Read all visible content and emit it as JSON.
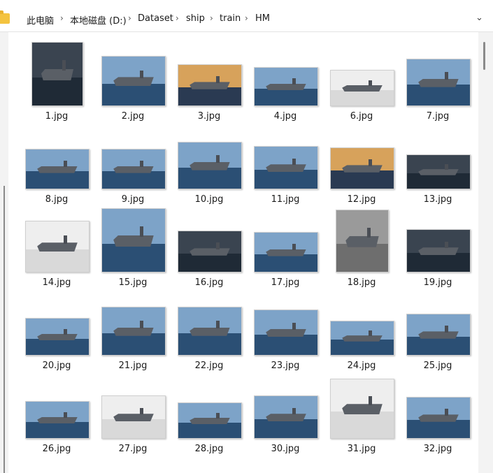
{
  "breadcrumb": {
    "items": [
      "此电脑",
      "本地磁盘 (D:)",
      "Dataset",
      "ship",
      "train",
      "HM"
    ],
    "separator_icon": "chevron-right-icon",
    "dropdown_icon": "chevron-down-icon"
  },
  "files": [
    {
      "name": "1.jpg",
      "style": "dark"
    },
    {
      "name": "2.jpg",
      "style": "sea"
    },
    {
      "name": "3.jpg",
      "style": "sunset"
    },
    {
      "name": "4.jpg",
      "style": "sea"
    },
    {
      "name": "6.jpg",
      "style": "light"
    },
    {
      "name": "7.jpg",
      "style": "sea"
    },
    {
      "name": "8.jpg",
      "style": "sea"
    },
    {
      "name": "9.jpg",
      "style": "sea"
    },
    {
      "name": "10.jpg",
      "style": "sea"
    },
    {
      "name": "11.jpg",
      "style": "sea"
    },
    {
      "name": "12.jpg",
      "style": "sunset"
    },
    {
      "name": "13.jpg",
      "style": "dark"
    },
    {
      "name": "14.jpg",
      "style": "light"
    },
    {
      "name": "15.jpg",
      "style": "sea"
    },
    {
      "name": "16.jpg",
      "style": "dark"
    },
    {
      "name": "17.jpg",
      "style": "sea"
    },
    {
      "name": "18.jpg",
      "style": "gray"
    },
    {
      "name": "19.jpg",
      "style": "dark"
    },
    {
      "name": "20.jpg",
      "style": "sea"
    },
    {
      "name": "21.jpg",
      "style": "sea"
    },
    {
      "name": "22.jpg",
      "style": "sea"
    },
    {
      "name": "23.jpg",
      "style": "sea"
    },
    {
      "name": "24.jpg",
      "style": "sea"
    },
    {
      "name": "25.jpg",
      "style": "sea"
    },
    {
      "name": "26.jpg",
      "style": "sea"
    },
    {
      "name": "27.jpg",
      "style": "light"
    },
    {
      "name": "28.jpg",
      "style": "sea"
    },
    {
      "name": "30.jpg",
      "style": "sea"
    },
    {
      "name": "31.jpg",
      "style": "light"
    },
    {
      "name": "32.jpg",
      "style": "sea"
    }
  ]
}
